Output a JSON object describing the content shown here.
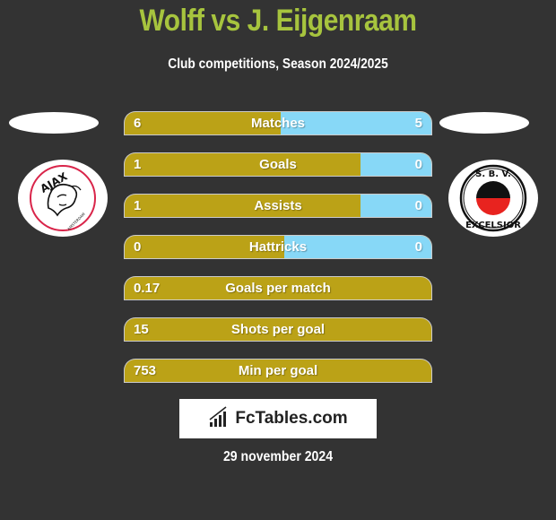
{
  "header": {
    "title": "Wolff vs J. Eijgenraam",
    "subtitle": "Club competitions, Season 2024/2025"
  },
  "colors": {
    "background": "#333333",
    "title": "#a7c43e",
    "left_bar": "#bba217",
    "right_bar": "#87d8f7"
  },
  "teams": {
    "left": {
      "name": "Ajax",
      "logo_icon": "ajax-crest-icon",
      "logo_text": "AJAX",
      "logo_subtext": "AMSTERDAM"
    },
    "right": {
      "name": "Excelsior",
      "logo_icon": "excelsior-crest-icon",
      "logo_top_text": "S. B. V.",
      "logo_bottom_text": "EXCELSIOR"
    }
  },
  "stats": [
    {
      "label": "Matches",
      "left": "6",
      "right": "5",
      "right_share": 0.49
    },
    {
      "label": "Goals",
      "left": "1",
      "right": "0",
      "right_share": 0.23
    },
    {
      "label": "Assists",
      "left": "1",
      "right": "0",
      "right_share": 0.23
    },
    {
      "label": "Hattricks",
      "left": "0",
      "right": "0",
      "right_share": 0.48
    },
    {
      "label": "Goals per match",
      "left": "0.17",
      "right": "",
      "right_share": 0
    },
    {
      "label": "Shots per goal",
      "left": "15",
      "right": "",
      "right_share": 0
    },
    {
      "label": "Min per goal",
      "left": "753",
      "right": "",
      "right_share": 0
    }
  ],
  "footer": {
    "brand": "FcTables.com",
    "brand_icon": "bar-chart-icon",
    "date": "29 november 2024"
  }
}
